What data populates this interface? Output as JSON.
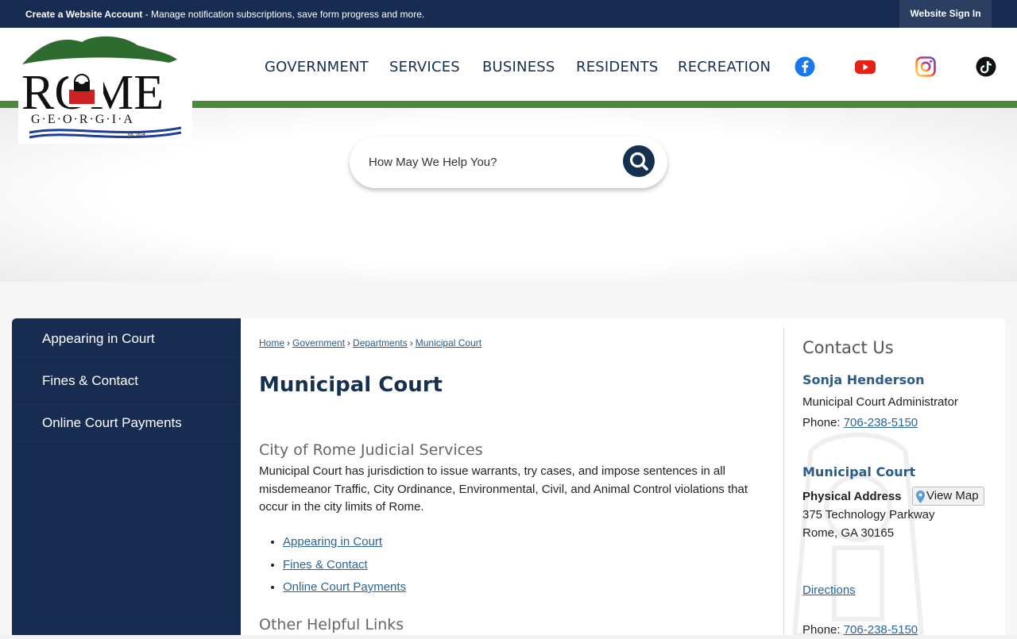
{
  "topbar": {
    "create_account": "Create a Website Account",
    "message": " - Manage notification subscriptions, save form progress and more.",
    "sign_in": "Website Sign In"
  },
  "logo": {
    "name": "ROME",
    "state": "G·E·O·R·G·I·A",
    "est": "est. 1834"
  },
  "nav": {
    "items": [
      "GOVERNMENT",
      "SERVICES",
      "BUSINESS",
      "RESIDENTS",
      "RECREATION"
    ]
  },
  "social": [
    "facebook-icon",
    "youtube-icon",
    "instagram-icon",
    "tiktok-icon"
  ],
  "search": {
    "placeholder": "How May We Help You?"
  },
  "sidebar": {
    "items": [
      {
        "label": "Appearing in Court"
      },
      {
        "label": "Fines & Contact"
      },
      {
        "label": "Online Court Payments"
      }
    ]
  },
  "breadcrumb": [
    "Home",
    "Government",
    "Departments",
    "Municipal Court"
  ],
  "main": {
    "title": "Municipal Court",
    "section_title": "City of Rome Judicial Services",
    "paragraph": "Municipal Court has jurisdiction to issue warrants, try cases, and impose sentences in all misdemeanor Traffic, City Ordinance, Environmental, Civil, and Animal Control violations that occur in the city limits of Rome.",
    "links": [
      "Appearing in Court",
      "Fines & Contact",
      "Online Court Payments"
    ],
    "other_title": "Other Helpful Links"
  },
  "contact": {
    "title": "Contact Us",
    "person": "Sonja Henderson",
    "role": "Municipal Court Administrator",
    "phone_label": "Phone:",
    "phone": "706-238-5150",
    "dept": "Municipal Court",
    "address_label": "Physical Address",
    "view_map": "View Map",
    "address1": "375 Technology Parkway",
    "address2": "Rome, GA 30165",
    "directions": "Directions",
    "phone2_label": "Phone:",
    "phone2": "706-238-5150"
  },
  "colors": {
    "navy": "#182c52",
    "green": "#4a8a3a",
    "link": "#2a6496"
  }
}
